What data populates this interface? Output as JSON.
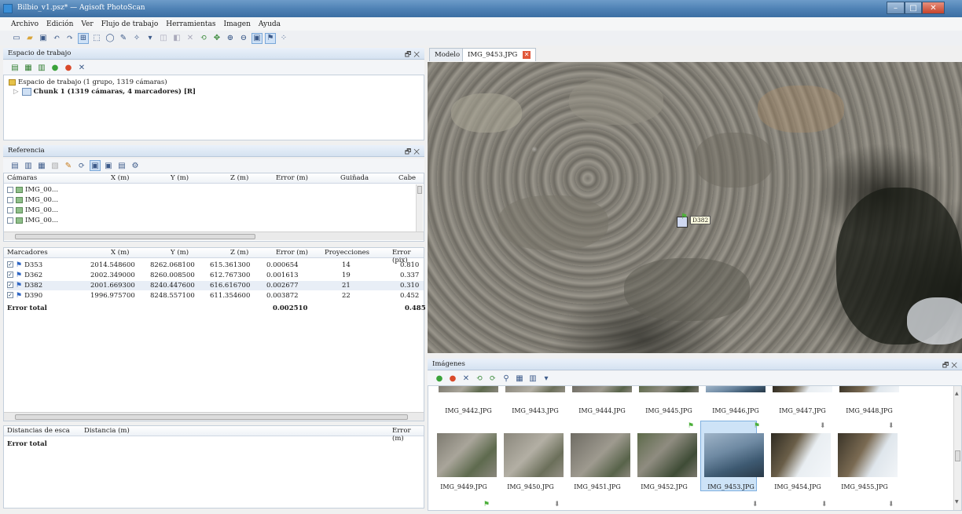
{
  "window": {
    "title": "Bilbio_v1.psz* — Agisoft PhotoScan"
  },
  "menu": [
    "Archivo",
    "Edición",
    "Ver",
    "Flujo de trabajo",
    "Herramientas",
    "Imagen",
    "Ayuda"
  ],
  "workspace": {
    "title": "Espacio de trabajo",
    "root": "Espacio de trabajo (1 grupo, 1319 cámaras)",
    "chunk": "Chunk 1 (1319 cámaras, 4 marcadores) [R]"
  },
  "reference": {
    "title": "Referencia",
    "cameras_header": [
      "Cámaras",
      "X (m)",
      "Y (m)",
      "Z (m)",
      "Error (m)",
      "Guiñada",
      "Cabe"
    ],
    "cameras": [
      "IMG_00...",
      "IMG_00...",
      "IMG_00...",
      "IMG_00..."
    ],
    "markers_header": [
      "Marcadores",
      "X (m)",
      "Y (m)",
      "Z (m)",
      "Error (m)",
      "Proyecciones",
      "Error (pix)"
    ],
    "markers": [
      {
        "name": "D353",
        "x": "2014.548600",
        "y": "8262.068100",
        "z": "615.361300",
        "err": "0.000654",
        "proj": "14",
        "errpix": "0.810"
      },
      {
        "name": "D362",
        "x": "2002.349000",
        "y": "8260.008500",
        "z": "612.767300",
        "err": "0.001613",
        "proj": "19",
        "errpix": "0.337"
      },
      {
        "name": "D382",
        "x": "2001.669300",
        "y": "8240.447600",
        "z": "616.616700",
        "err": "0.002677",
        "proj": "21",
        "errpix": "0.310"
      },
      {
        "name": "D390",
        "x": "1996.975700",
        "y": "8248.557100",
        "z": "611.354600",
        "err": "0.003872",
        "proj": "22",
        "errpix": "0.452"
      }
    ],
    "total_label": "Error total",
    "total_err": "0.002510",
    "total_errpix": "0.485",
    "distances_header": [
      "Distancias de esca",
      "Distancia (m)",
      "Error (m)"
    ],
    "distances_total": "Error total"
  },
  "tabs": {
    "model": "Modelo",
    "image": "IMG_9453.JPG"
  },
  "viewer": {
    "marker_label": "D382"
  },
  "images": {
    "title": "Imágenes",
    "row1": [
      "IMG_9442.JPG",
      "IMG_9443.JPG",
      "IMG_9444.JPG",
      "IMG_9445.JPG",
      "IMG_9446.JPG",
      "IMG_9447.JPG",
      "IMG_9448.JPG"
    ],
    "row2": [
      "IMG_9449.JPG",
      "IMG_9450.JPG",
      "IMG_9451.JPG",
      "IMG_9452.JPG",
      "IMG_9453.JPG",
      "IMG_9454.JPG",
      "IMG_9455.JPG"
    ]
  },
  "icons": {
    "close": "✕",
    "float": "🗗",
    "minimize": "–",
    "maximize": "□",
    "flag": "⚑",
    "pin": "⬇",
    "check": "✓",
    "dropdown": "▾",
    "expand": "▷",
    "scroll_up": "▲",
    "scroll_down": "▼",
    "scroll_left": "◂",
    "scroll_right": "▸"
  }
}
